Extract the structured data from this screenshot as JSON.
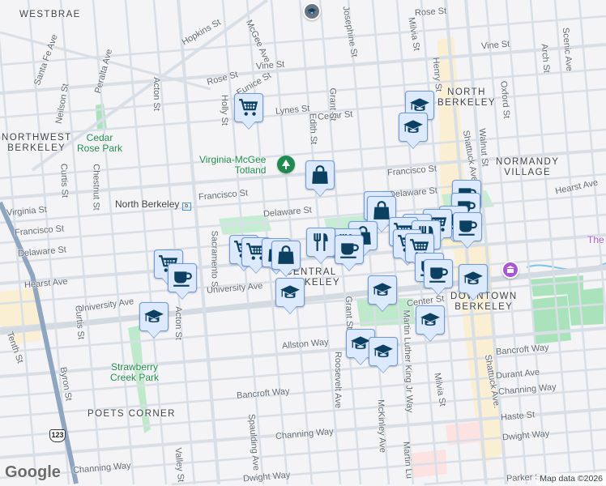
{
  "districts": {
    "westbrae": "WESTBRAE",
    "northwest_berkeley": [
      "NORTHWEST",
      "BERKELEY"
    ],
    "north_berkeley": [
      "NORTH",
      "BERKELEY"
    ],
    "normandy_village": [
      "NORMANDY",
      "VILLAGE"
    ],
    "downtown_berkeley": [
      "DOWNTOWN",
      "BERKELEY"
    ],
    "central_berkeley": [
      "CENTRAL",
      "BERKELEY"
    ],
    "poets_corner": "POETS CORNER"
  },
  "parks": {
    "cedar_rose": [
      "Cedar",
      "Rose Park"
    ],
    "totland": [
      "Virginia-McGee",
      "Totland"
    ],
    "strawberry_creek": [
      "Strawberry",
      "Creek Park"
    ]
  },
  "transit": {
    "station": "North Berkeley"
  },
  "streets": [
    "Hopkins St",
    "McGee Ave",
    "Rose St",
    "Rose St",
    "Holly St",
    "Acton St",
    "Santa Fe Ave",
    "Neilson St",
    "Peralta Ave",
    "Cedar St",
    "Edith St",
    "Grant St",
    "Josephine St",
    "Milvia St",
    "Henry St",
    "Vine St",
    "Vine St",
    "Shattuck Ave.",
    "Walnut St",
    "Oxford St",
    "Arch St",
    "Scenic Ave",
    "Francisco St",
    "Francisco St",
    "Francisco St",
    "Hearst Ave",
    "Hearst Ave",
    "Delaware St",
    "Delaware St",
    "Delaware St",
    "Virginia St",
    "Curtis St",
    "Chestnut St",
    "Sacramento St",
    "University Ave",
    "University Ave",
    "Acton St",
    "Tenth St",
    "Byron St",
    "Curtis St",
    "Channing Way",
    "Channing Way",
    "Channing Way",
    "Valley St",
    "Spaulding Ave",
    "Dwight Way",
    "Dwight Way",
    "Bancroft Way",
    "Bancroft Way",
    "Allston Way",
    "Roosevelt Ave",
    "Grant St",
    "Center St",
    "McKinley Ave",
    "Martin Luther King Jr Way",
    "Martin Lu",
    "Milvia St",
    "Shattuck Ave.",
    "Durant Ave",
    "Haste St",
    "Parker St",
    "Eunice St",
    "Lynes St"
  ],
  "partial_poi": "The",
  "highway_shield": "123",
  "logo": "Google",
  "attribution": "Map data ©2026",
  "colors": {
    "marker_bg": "#dde9fc",
    "marker_border": "#6d9ad9",
    "marker_icon": "#0b4060",
    "park": "#c6ecd3",
    "commercial": "#fbefd3",
    "highway": "#8fa6c0"
  },
  "markers": [
    {
      "icon": "shopping-cart-icon"
    },
    {
      "icon": "graduation-cap-icon"
    },
    {
      "icon": "graduation-cap-icon"
    },
    {
      "icon": "shopping-bag-icon"
    },
    {
      "icon": "shopping-bag-icon"
    },
    {
      "icon": "shopping-bag-icon"
    },
    {
      "icon": "coffee-cup-icon"
    },
    {
      "icon": "coffee-cup-icon"
    },
    {
      "icon": "coffee-cup-icon"
    },
    {
      "icon": "shopping-cart-icon"
    },
    {
      "icon": "coffee-cup-icon"
    },
    {
      "icon": "shopping-cart-icon"
    },
    {
      "icon": "shopping-cart-icon"
    },
    {
      "icon": "restaurant-icon"
    },
    {
      "icon": "shopping-bag-icon"
    },
    {
      "icon": "restaurant-icon"
    },
    {
      "icon": "shopping-cart-icon"
    },
    {
      "icon": "restaurant-icon"
    },
    {
      "icon": "shopping-cart-icon"
    },
    {
      "icon": "coffee-cup-icon"
    },
    {
      "icon": "shopping-cart-icon"
    },
    {
      "icon": "shopping-cart-icon"
    },
    {
      "icon": "shopping-bag-icon"
    },
    {
      "icon": "shopping-bag-icon"
    },
    {
      "icon": "shopping-cart-icon"
    },
    {
      "icon": "coffee-cup-icon"
    },
    {
      "icon": "graduation-cap-icon"
    },
    {
      "icon": "graduation-cap-icon"
    },
    {
      "icon": "coffee-cup-icon"
    },
    {
      "icon": "coffee-cup-icon"
    },
    {
      "icon": "graduation-cap-icon"
    },
    {
      "icon": "graduation-cap-icon"
    },
    {
      "icon": "graduation-cap-icon"
    },
    {
      "icon": "graduation-cap-icon"
    },
    {
      "icon": "graduation-cap-icon"
    }
  ]
}
